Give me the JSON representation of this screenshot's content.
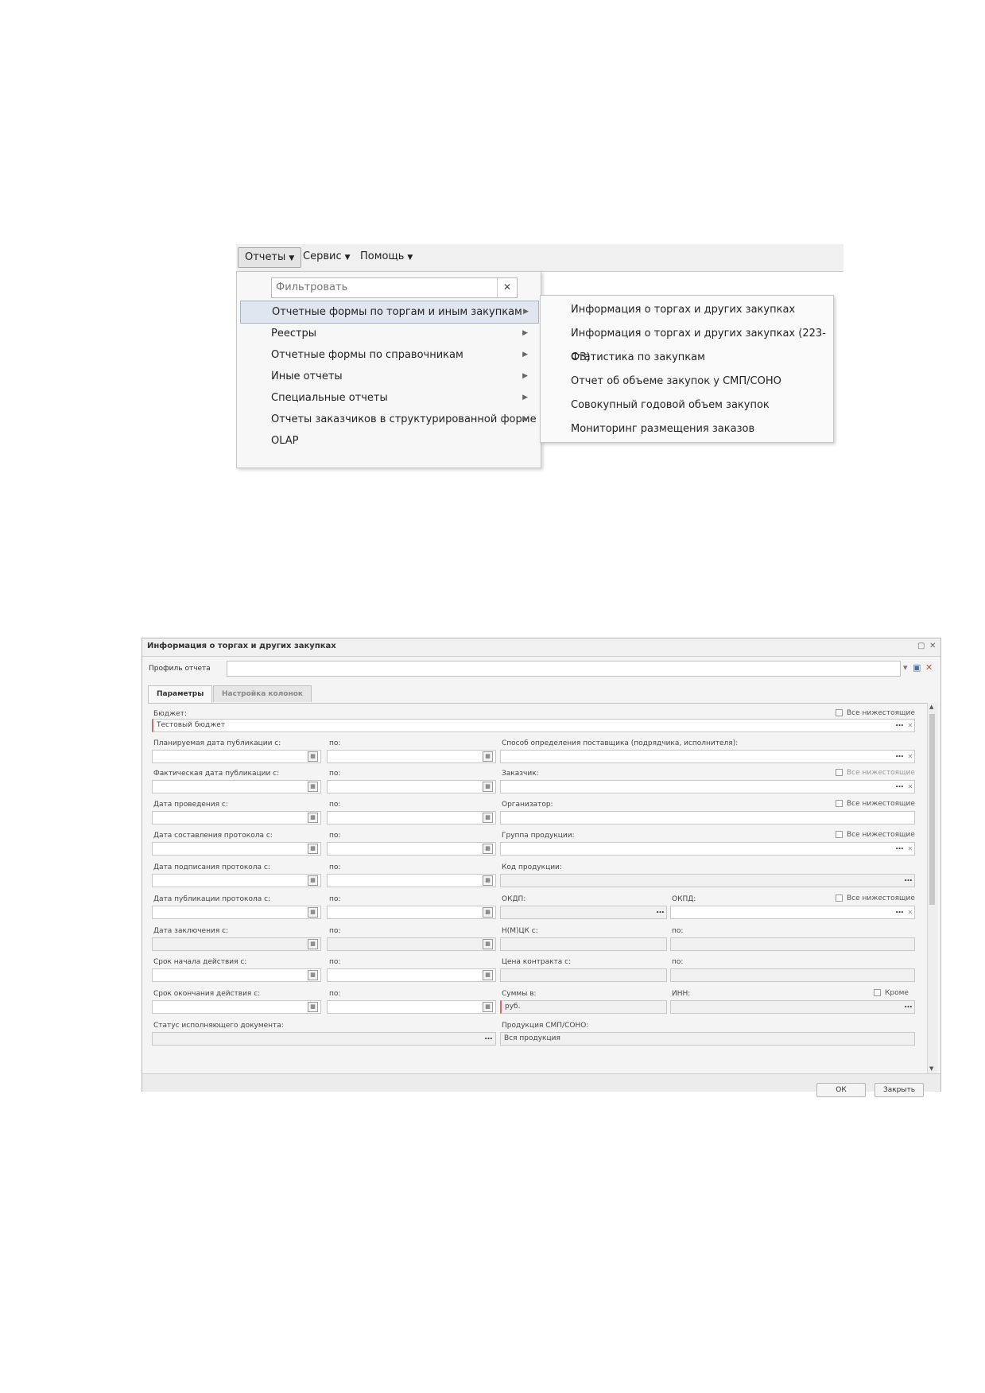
{
  "menu": {
    "menubar": [
      {
        "label": "Отчеты"
      },
      {
        "label": "Сервис"
      },
      {
        "label": "Помощь"
      }
    ],
    "filter_placeholder": "Фильтровать",
    "items": [
      {
        "label": "Отчетные формы по торгам и иным закупкам"
      },
      {
        "label": "Реестры"
      },
      {
        "label": "Отчетные формы по справочникам"
      },
      {
        "label": "Иные отчеты"
      },
      {
        "label": "Специальные отчеты"
      },
      {
        "label": "Отчеты заказчиков в структурированной форме"
      },
      {
        "label": "OLAP"
      }
    ],
    "submenu": [
      {
        "label": "Информация о торгах и других закупках"
      },
      {
        "label": "Информация о торгах и других закупках (223-ФЗ)"
      },
      {
        "label": "Статистика по закупкам"
      },
      {
        "label": "Отчет об объеме закупок у СМП/СОНО"
      },
      {
        "label": "Совокупный годовой объем закупок"
      },
      {
        "label": "Мониторинг размещения заказов"
      }
    ]
  },
  "dialog": {
    "title": "Информация о торгах и других закупках",
    "profile_label": "Профиль отчета",
    "tabs": [
      "Параметры",
      "Настройка колонок"
    ],
    "labels": {
      "budget": "Бюджет:",
      "budget_value": "Тестовый бюджет",
      "all_lower": "Все нижестоящие",
      "plan_pub": "Планируемая дата публикации с:",
      "to": "по:",
      "supplier_method": "Способ определения поставщика (подрядчика, исполнителя):",
      "fact_pub": "Фактическая дата публикации с:",
      "customer": "Заказчик:",
      "hold_date": "Дата проведения с:",
      "organizer": "Организатор:",
      "protocol_date": "Дата составления протокола с:",
      "product_group": "Группа продукции:",
      "protocol_sign": "Дата подписания протокола с:",
      "product_code": "Код продукции:",
      "protocol_pub": "Дата публикации протокола с:",
      "okdp": "ОКДП:",
      "okpd": "ОКПД:",
      "conclusion_date": "Дата заключения с:",
      "nmck": "Н(М)ЦК с:",
      "start_term": "Срок начала действия с:",
      "contract_price": "Цена контракта с:",
      "end_term": "Срок окончания действия с:",
      "sums_in": "Суммы в:",
      "inn": "ИНН:",
      "except": "Кроме",
      "rub": "руб.",
      "exec_status": "Статус исполняющего документа:",
      "smp_products": "Продукция СМП/СОНО:",
      "all_products": "Вся продукция"
    },
    "buttons": {
      "ok": "ОК",
      "close": "Закрыть"
    }
  }
}
